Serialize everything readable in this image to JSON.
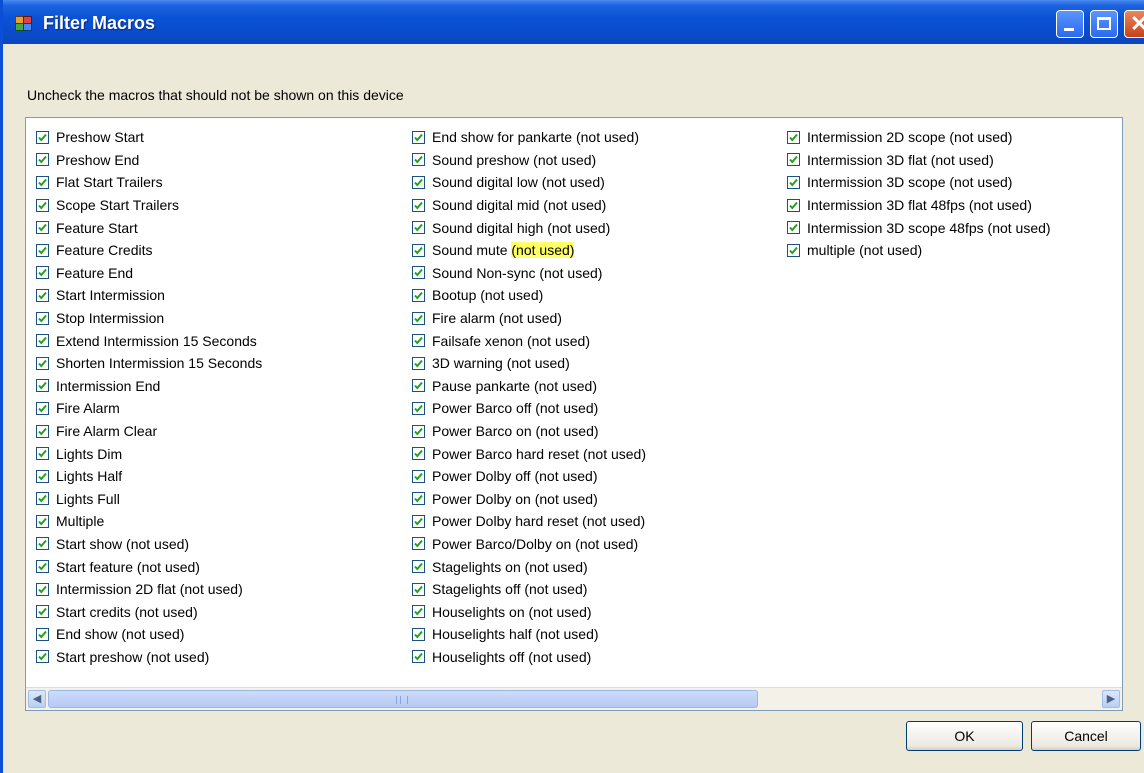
{
  "window": {
    "title": "Filter Macros"
  },
  "instruction": "Uncheck the macros that should not be shown on this device",
  "columns": [
    [
      "Preshow Start",
      "Preshow End",
      "Flat Start Trailers",
      "Scope Start Trailers",
      "Feature Start",
      "Feature Credits",
      "Feature End",
      "Start Intermission",
      "Stop Intermission",
      "Extend Intermission 15 Seconds",
      "Shorten Intermission 15 Seconds",
      "Intermission End",
      "Fire Alarm",
      "Fire Alarm Clear",
      "Lights Dim",
      "Lights Half",
      "Lights Full",
      "Multiple",
      "Start show (not used)",
      "Start feature (not used)",
      "Intermission 2D flat (not used)",
      "Start credits (not used)",
      "End show (not used)",
      "Start preshow (not used)"
    ],
    [
      "End show for pankarte (not used)",
      "Sound preshow (not used)",
      "Sound digital low (not used)",
      "Sound digital mid (not used)",
      "Sound digital high (not used)",
      "Sound mute (not used)",
      "Sound Non-sync (not used)",
      "Bootup (not used)",
      "Fire alarm (not used)",
      "Failsafe xenon (not used)",
      "3D warning (not used)",
      "Pause pankarte (not used)",
      "Power Barco off (not used)",
      "Power Barco on (not used)",
      "Power Barco hard reset (not used)",
      "Power Dolby off (not used)",
      "Power Dolby on (not used)",
      "Power Dolby hard reset (not used)",
      "Power Barco/Dolby on (not used)",
      "Stagelights on (not used)",
      "Stagelights off (not used)",
      "Houselights on (not used)",
      "Houselights half (not used)",
      "Houselights off (not used)"
    ],
    [
      "Intermission 2D scope (not used)",
      "Intermission 3D flat (not used)",
      "Intermission 3D scope (not used)",
      "Intermission 3D flat 48fps (not used)",
      "Intermission 3D scope 48fps (not used)",
      "multiple (not used)"
    ]
  ],
  "highlight": {
    "column": 1,
    "index": 5,
    "prefix": "Sound mute ",
    "marked": "(not used)",
    "color": "#ffff66"
  },
  "checked": true,
  "buttons": {
    "ok": "OK",
    "cancel": "Cancel"
  },
  "colors": {
    "titlebar": "#0a53d6",
    "check": "#21a121",
    "dialog": "#ece9d8"
  }
}
